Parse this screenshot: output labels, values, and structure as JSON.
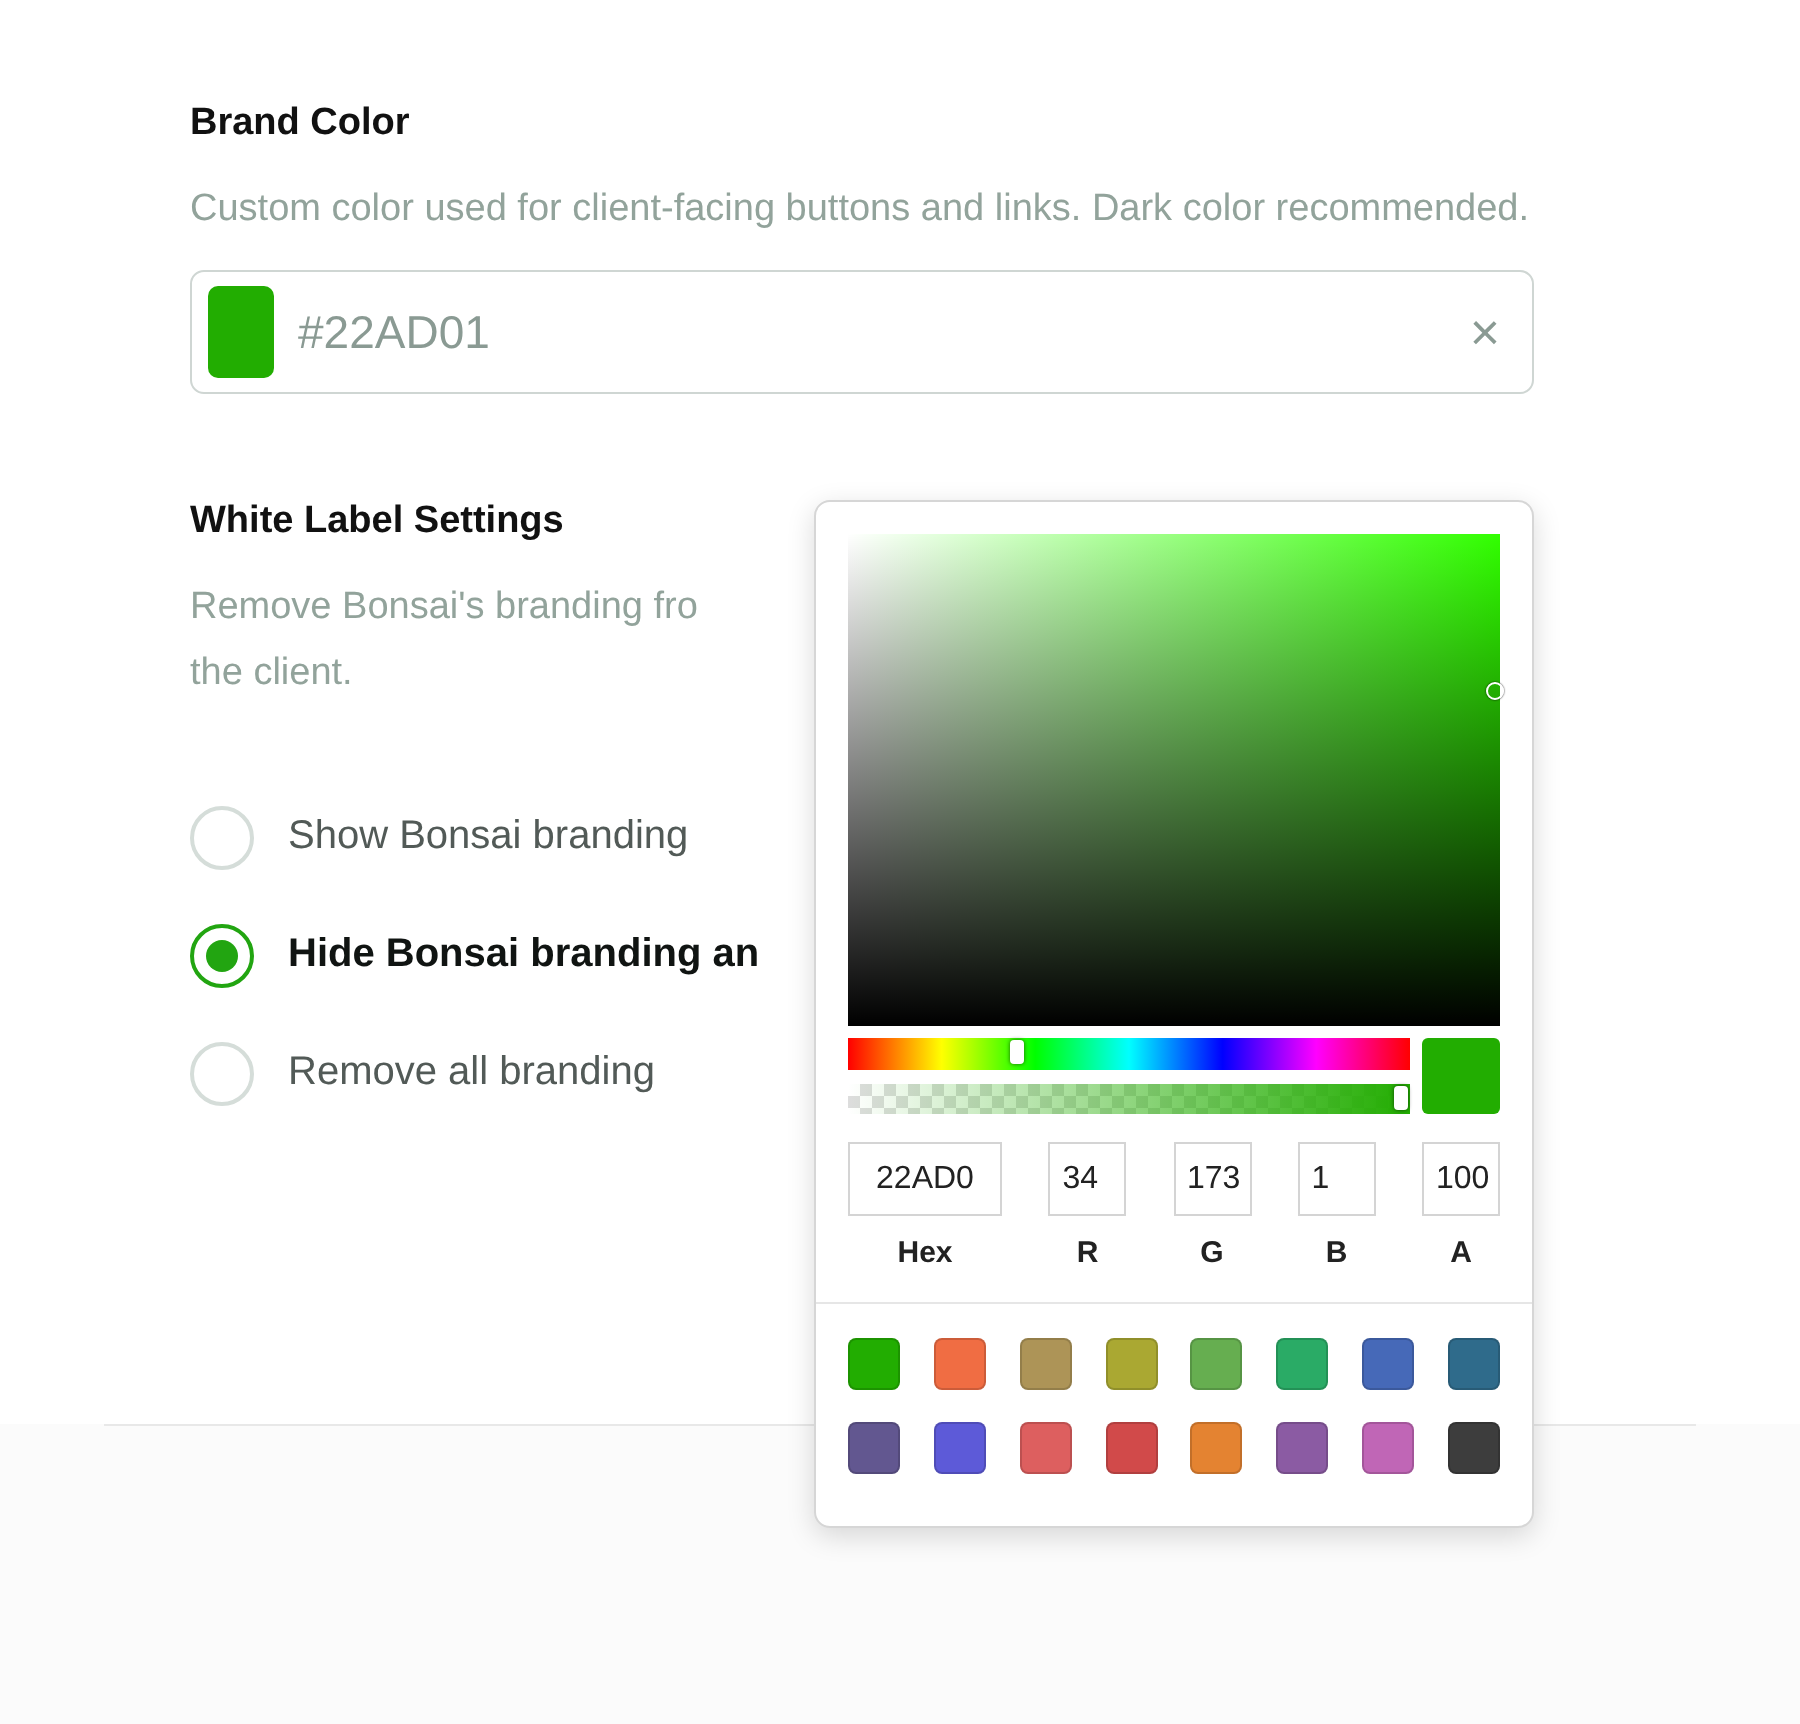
{
  "brand_color": {
    "title": "Brand Color",
    "description": "Custom color used for client-facing buttons and links. Dark color recommended.",
    "field": {
      "value": "#22AD01",
      "color": "#22ad01",
      "clear": "×"
    }
  },
  "white_label": {
    "title": "White Label Settings",
    "description_lines": [
      "Remove Bonsai's branding fro",
      "the client."
    ],
    "options": [
      {
        "label": "Show Bonsai branding",
        "selected": false
      },
      {
        "label": "Hide Bonsai branding an",
        "selected": true
      },
      {
        "label": "Remove all branding",
        "selected": false
      }
    ]
  },
  "color_picker": {
    "alpha_slider": {
      "level": 1
    },
    "inputs": [
      {
        "value": "22AD0",
        "label": "Hex"
      },
      {
        "value": "34",
        "label": "R"
      },
      {
        "value": "173",
        "label": "G"
      },
      {
        "value": "1",
        "label": "B"
      },
      {
        "value": "100",
        "label": "A"
      }
    ],
    "presets": [
      {
        "color": "#22ad01"
      },
      {
        "color": "#f06d43"
      },
      {
        "color": "#ad9457"
      },
      {
        "color": "#aaa832"
      },
      {
        "color": "#66ae50"
      },
      {
        "color": "#2aab66"
      },
      {
        "color": "#4669b8"
      },
      {
        "color": "#2f6b8b"
      },
      {
        "color": "#625790"
      },
      {
        "color": "#5d5ad8"
      },
      {
        "color": "#dd5f5f"
      },
      {
        "color": "#d14a4a"
      },
      {
        "color": "#e48331"
      },
      {
        "color": "#8b5ba3"
      },
      {
        "color": "#c066b6"
      },
      {
        "color": "#3d3d3d"
      }
    ]
  }
}
